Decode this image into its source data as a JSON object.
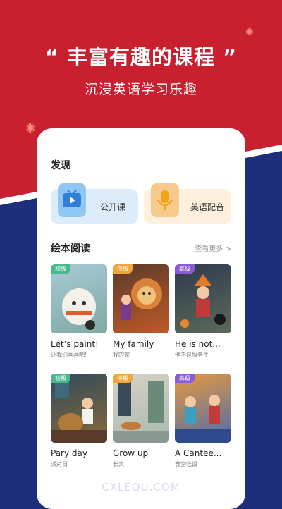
{
  "promo": {
    "headline": "“ 丰富有趣的课程 ”",
    "subline": "沉浸英语学习乐趣"
  },
  "discover": {
    "title": "发现",
    "cards": [
      {
        "label": "公开课",
        "icon": "tv-icon"
      },
      {
        "label": "英语配音",
        "icon": "microphone-icon"
      }
    ]
  },
  "picture_books": {
    "title": "绘本阅读",
    "more_label": "查看更多 >",
    "books": [
      {
        "level": "初级",
        "title": "Let’s paint!",
        "subtitle": "让我们画画吧!"
      },
      {
        "level": "中级",
        "title": "My family",
        "subtitle": "我的家"
      },
      {
        "level": "高级",
        "title": "He is not...",
        "subtitle": "他不是服务生"
      },
      {
        "level": "初级",
        "title": "Pary day",
        "subtitle": "派对日"
      },
      {
        "level": "中级",
        "title": "Grow up",
        "subtitle": "长大"
      },
      {
        "level": "高级",
        "title": "A Cantee...",
        "subtitle": "食堂吃饭"
      }
    ]
  },
  "colors": {
    "red": "#c8202f",
    "navy": "#1d2f7a",
    "level_beginner": "#47b98c",
    "level_intermediate": "#f0a63a",
    "level_advanced": "#8a5bd6"
  },
  "watermark": "CXLEQU.COM"
}
